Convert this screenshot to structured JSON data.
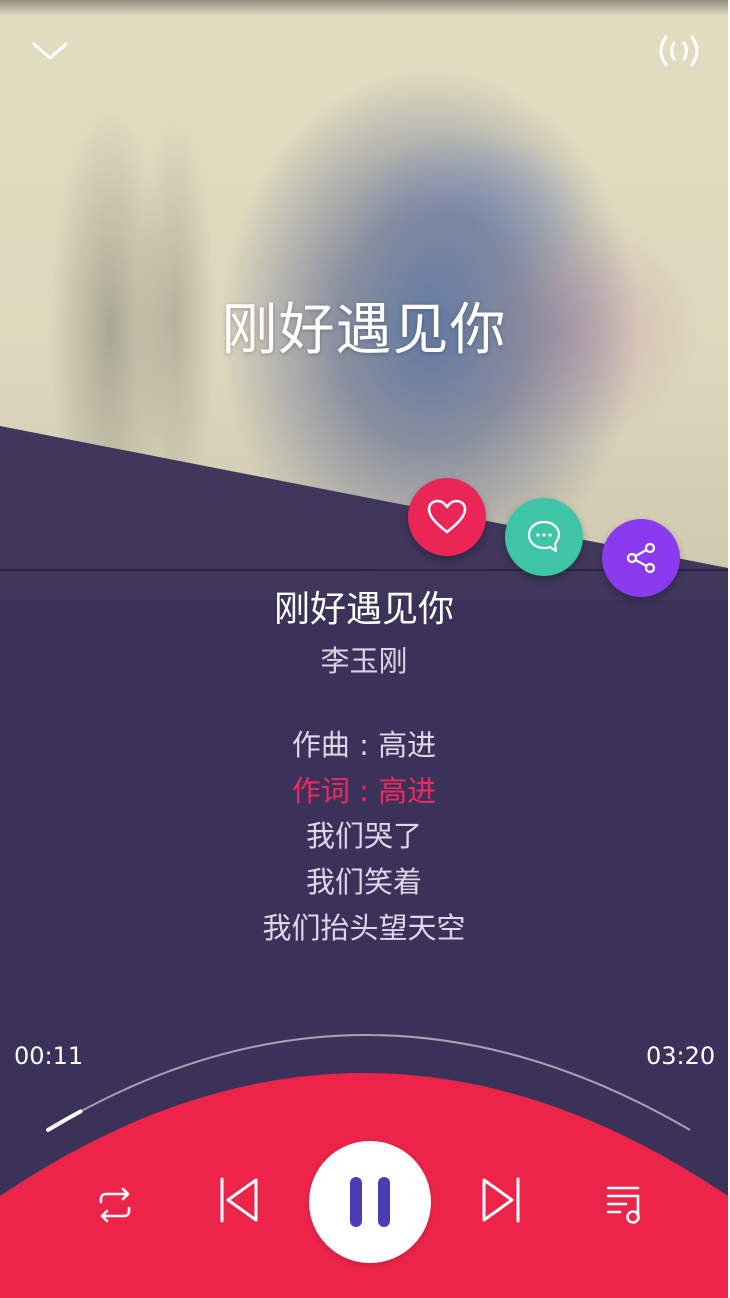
{
  "header": {
    "collapse_icon": "chevron-down-icon",
    "cast_icon": "broadcast-icon"
  },
  "cover": {
    "title": "刚好遇见你"
  },
  "actions": {
    "like_icon": "heart-icon",
    "comment_icon": "comment-icon",
    "share_icon": "share-icon",
    "colors": {
      "like": "#ec2557",
      "comment": "#3ec5a6",
      "share": "#8a3bf0"
    }
  },
  "song": {
    "title": "刚好遇见你",
    "artist": "李玉刚"
  },
  "lyrics": {
    "lines": [
      {
        "text": "作曲 : 高进",
        "active": false
      },
      {
        "text": "作词 : 高进",
        "active": true
      },
      {
        "text": "我们哭了",
        "active": false
      },
      {
        "text": "我们笑着",
        "active": false
      },
      {
        "text": "我们抬头望天空",
        "active": false
      }
    ]
  },
  "progress": {
    "elapsed": "00:11",
    "total": "03:20",
    "fraction": 0.055
  },
  "controls": {
    "repeat_icon": "repeat-icon",
    "prev_icon": "skip-previous-icon",
    "play_state_icon": "pause-icon",
    "next_icon": "skip-next-icon",
    "playlist_icon": "playlist-icon",
    "accent_color": "#ec2449"
  }
}
